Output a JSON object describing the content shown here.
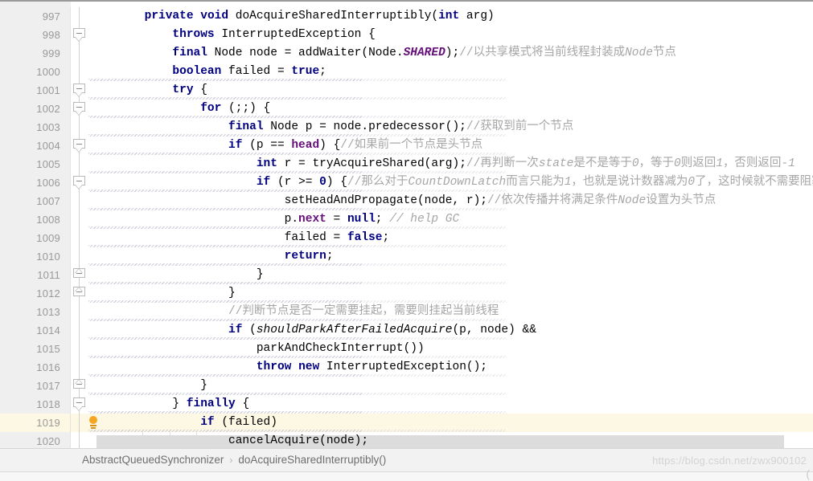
{
  "editor": {
    "first_visible_line": 997,
    "highlighted_line": 1019,
    "selected_line": 1020,
    "colors": {
      "keyword": "#000080",
      "field": "#660E7A",
      "comment": "#a6a6a6",
      "gutter_bg": "#efefef",
      "highlight_bg": "#fdf8e3",
      "selection_bg": "#dcdcdc",
      "bulb": "#f5a623"
    },
    "lines": [
      {
        "no": "997",
        "fold": "none",
        "bulb": false,
        "guides": [],
        "squiggle": 0,
        "tokens": [
          {
            "t": "        ",
            "c": ""
          },
          {
            "t": "private",
            "c": "kw"
          },
          {
            "t": " ",
            "c": ""
          },
          {
            "t": "void",
            "c": "kw"
          },
          {
            "t": " doAcquireSharedInterruptibly(",
            "c": ""
          },
          {
            "t": "int",
            "c": "kw"
          },
          {
            "t": " arg)",
            "c": ""
          }
        ]
      },
      {
        "no": "998",
        "fold": "down",
        "bulb": false,
        "guides": [],
        "squiggle": 0,
        "tokens": [
          {
            "t": "            ",
            "c": ""
          },
          {
            "t": "throws",
            "c": "kw"
          },
          {
            "t": " InterruptedException {",
            "c": ""
          }
        ]
      },
      {
        "no": "999",
        "fold": "none",
        "bulb": false,
        "guides": [],
        "squiggle": 0,
        "tokens": [
          {
            "t": "            ",
            "c": ""
          },
          {
            "t": "final",
            "c": "kw"
          },
          {
            "t": " Node node = addWaiter(Node.",
            "c": ""
          },
          {
            "t": "SHARED",
            "c": "cst"
          },
          {
            "t": ");",
            "c": ""
          },
          {
            "t": "//以共享模式将当前线程封装成",
            "c": "cmt"
          },
          {
            "t": "Node",
            "c": "cmt-i"
          },
          {
            "t": "节点",
            "c": "cmt"
          }
        ]
      },
      {
        "no": "1000",
        "fold": "none",
        "bulb": false,
        "guides": [
          1
        ],
        "squiggle": 340,
        "tokens": [
          {
            "t": "            ",
            "c": ""
          },
          {
            "t": "boolean",
            "c": "kw"
          },
          {
            "t": " failed = ",
            "c": ""
          },
          {
            "t": "true",
            "c": "kw"
          },
          {
            "t": ";",
            "c": ""
          }
        ]
      },
      {
        "no": "1001",
        "fold": "down",
        "bulb": false,
        "guides": [
          1
        ],
        "squiggle": 340,
        "tokens": [
          {
            "t": "            ",
            "c": ""
          },
          {
            "t": "try",
            "c": "kw"
          },
          {
            "t": " {",
            "c": ""
          }
        ]
      },
      {
        "no": "1002",
        "fold": "down",
        "bulb": false,
        "guides": [
          1,
          2
        ],
        "squiggle": 340,
        "tokens": [
          {
            "t": "                ",
            "c": ""
          },
          {
            "t": "for",
            "c": "kw"
          },
          {
            "t": " (;;) {",
            "c": ""
          }
        ]
      },
      {
        "no": "1003",
        "fold": "none",
        "bulb": false,
        "guides": [
          1,
          2,
          3
        ],
        "squiggle": 340,
        "tokens": [
          {
            "t": "                    ",
            "c": ""
          },
          {
            "t": "final",
            "c": "kw"
          },
          {
            "t": " Node p = node.predecessor();",
            "c": ""
          },
          {
            "t": "//获取到前一个节点",
            "c": "cmt"
          }
        ]
      },
      {
        "no": "1004",
        "fold": "down",
        "bulb": false,
        "guides": [
          1,
          2,
          3
        ],
        "squiggle": 340,
        "tokens": [
          {
            "t": "                    ",
            "c": ""
          },
          {
            "t": "if",
            "c": "kw"
          },
          {
            "t": " (p == ",
            "c": ""
          },
          {
            "t": "head",
            "c": "fld"
          },
          {
            "t": ") {",
            "c": ""
          },
          {
            "t": "//如果前一个节点是头节点",
            "c": "cmt"
          }
        ]
      },
      {
        "no": "1005",
        "fold": "none",
        "bulb": false,
        "guides": [
          1,
          2,
          3,
          4
        ],
        "squiggle": 340,
        "tokens": [
          {
            "t": "                        ",
            "c": ""
          },
          {
            "t": "int",
            "c": "kw"
          },
          {
            "t": " r = tryAcquireShared(arg);",
            "c": ""
          },
          {
            "t": "//再判断一次",
            "c": "cmt"
          },
          {
            "t": "state",
            "c": "cmt-i"
          },
          {
            "t": "是不是等于",
            "c": "cmt"
          },
          {
            "t": "0",
            "c": "cmt-i"
          },
          {
            "t": "，等于",
            "c": "cmt"
          },
          {
            "t": "0",
            "c": "cmt-i"
          },
          {
            "t": "则返回",
            "c": "cmt"
          },
          {
            "t": "1",
            "c": "cmt-i"
          },
          {
            "t": "，否则返回",
            "c": "cmt"
          },
          {
            "t": "-1",
            "c": "cmt-i"
          }
        ]
      },
      {
        "no": "1006",
        "fold": "down",
        "bulb": false,
        "guides": [
          1,
          2,
          3,
          4
        ],
        "squiggle": 340,
        "tokens": [
          {
            "t": "                        ",
            "c": ""
          },
          {
            "t": "if",
            "c": "kw"
          },
          {
            "t": " (r >= ",
            "c": ""
          },
          {
            "t": "0",
            "c": "kw"
          },
          {
            "t": ") {",
            "c": ""
          },
          {
            "t": "//那么对于",
            "c": "cmt"
          },
          {
            "t": "CountDownLatch",
            "c": "cmt-i"
          },
          {
            "t": "而言只能为",
            "c": "cmt"
          },
          {
            "t": "1",
            "c": "cmt-i"
          },
          {
            "t": "，也就是说计数器减为",
            "c": "cmt"
          },
          {
            "t": "0",
            "c": "cmt-i"
          },
          {
            "t": "了，这时候就不需要阻塞了",
            "c": "cmt"
          }
        ]
      },
      {
        "no": "1007",
        "fold": "none",
        "bulb": false,
        "guides": [
          1,
          2,
          3,
          4,
          5
        ],
        "squiggle": 340,
        "tokens": [
          {
            "t": "                            setHeadAndPropagate(node, r);",
            "c": ""
          },
          {
            "t": "//依次传播并将满足条件",
            "c": "cmt"
          },
          {
            "t": "Node",
            "c": "cmt-i"
          },
          {
            "t": "设置为头节点",
            "c": "cmt"
          }
        ]
      },
      {
        "no": "1008",
        "fold": "none",
        "bulb": false,
        "guides": [
          1,
          2,
          3,
          4,
          5
        ],
        "squiggle": 340,
        "tokens": [
          {
            "t": "                            p.",
            "c": ""
          },
          {
            "t": "next",
            "c": "fld"
          },
          {
            "t": " = ",
            "c": ""
          },
          {
            "t": "null",
            "c": "kw"
          },
          {
            "t": "; ",
            "c": ""
          },
          {
            "t": "// help GC",
            "c": "gc"
          }
        ]
      },
      {
        "no": "1009",
        "fold": "none",
        "bulb": false,
        "guides": [
          1,
          2,
          3,
          4,
          5
        ],
        "squiggle": 340,
        "tokens": [
          {
            "t": "                            failed = ",
            "c": ""
          },
          {
            "t": "false",
            "c": "kw"
          },
          {
            "t": ";",
            "c": ""
          }
        ]
      },
      {
        "no": "1010",
        "fold": "none",
        "bulb": false,
        "guides": [
          1,
          2,
          3,
          4,
          5
        ],
        "squiggle": 340,
        "tokens": [
          {
            "t": "                            ",
            "c": ""
          },
          {
            "t": "return",
            "c": "kw"
          },
          {
            "t": ";",
            "c": ""
          }
        ]
      },
      {
        "no": "1011",
        "fold": "up",
        "bulb": false,
        "guides": [
          1,
          2,
          3,
          4
        ],
        "squiggle": 340,
        "tokens": [
          {
            "t": "                        }",
            "c": ""
          }
        ]
      },
      {
        "no": "1012",
        "fold": "up",
        "bulb": false,
        "guides": [
          1,
          2,
          3
        ],
        "squiggle": 340,
        "tokens": [
          {
            "t": "                    }",
            "c": ""
          }
        ]
      },
      {
        "no": "1013",
        "fold": "none",
        "bulb": false,
        "guides": [
          1,
          2,
          3
        ],
        "squiggle": 340,
        "tokens": [
          {
            "t": "                    ",
            "c": ""
          },
          {
            "t": "//判断节点是否一定需要挂起，需要则挂起当前线程",
            "c": "cmt"
          }
        ]
      },
      {
        "no": "1014",
        "fold": "none",
        "bulb": false,
        "guides": [
          1,
          2,
          3
        ],
        "squiggle": 340,
        "tokens": [
          {
            "t": "                    ",
            "c": ""
          },
          {
            "t": "if",
            "c": "kw"
          },
          {
            "t": " (",
            "c": ""
          },
          {
            "t": "shouldParkAfterFailedAcquire",
            "c": "itl"
          },
          {
            "t": "(p, node) &&",
            "c": ""
          }
        ]
      },
      {
        "no": "1015",
        "fold": "none",
        "bulb": false,
        "guides": [
          1,
          2,
          3,
          4
        ],
        "squiggle": 340,
        "tokens": [
          {
            "t": "                        parkAndCheckInterrupt())",
            "c": ""
          }
        ]
      },
      {
        "no": "1016",
        "fold": "none",
        "bulb": false,
        "guides": [
          1,
          2,
          3,
          4
        ],
        "squiggle": 340,
        "tokens": [
          {
            "t": "                        ",
            "c": ""
          },
          {
            "t": "throw",
            "c": "kw"
          },
          {
            "t": " ",
            "c": ""
          },
          {
            "t": "new",
            "c": "kw"
          },
          {
            "t": " InterruptedException();",
            "c": ""
          }
        ]
      },
      {
        "no": "1017",
        "fold": "up",
        "bulb": false,
        "guides": [
          1,
          2
        ],
        "squiggle": 340,
        "tokens": [
          {
            "t": "                }",
            "c": ""
          }
        ]
      },
      {
        "no": "1018",
        "fold": "down",
        "bulb": false,
        "guides": [
          1,
          2
        ],
        "squiggle": 340,
        "tokens": [
          {
            "t": "            } ",
            "c": ""
          },
          {
            "t": "finally",
            "c": "kw"
          },
          {
            "t": " {",
            "c": ""
          }
        ]
      },
      {
        "no": "1019",
        "fold": "none",
        "bulb": true,
        "guides": [
          1,
          2
        ],
        "squiggle": 340,
        "tokens": [
          {
            "t": "                ",
            "c": ""
          },
          {
            "t": "if",
            "c": "kw"
          },
          {
            "t": " (failed)",
            "c": ""
          }
        ]
      },
      {
        "no": "1020",
        "fold": "none",
        "bulb": false,
        "guides": [
          1,
          2,
          3
        ],
        "squiggle": 340,
        "scrollband": true,
        "tokens": [
          {
            "t": "                    cancelAcquire(node);",
            "c": ""
          }
        ]
      }
    ]
  },
  "statusbar": {
    "breadcrumb": [
      {
        "label": "AbstractQueuedSynchronizer"
      },
      {
        "label": "doAcquireSharedInterruptibly()"
      }
    ],
    "separator": "›"
  },
  "watermark": {
    "text": "https://blog.csdn.net/zwx900102"
  },
  "corner": {
    "text": "("
  }
}
